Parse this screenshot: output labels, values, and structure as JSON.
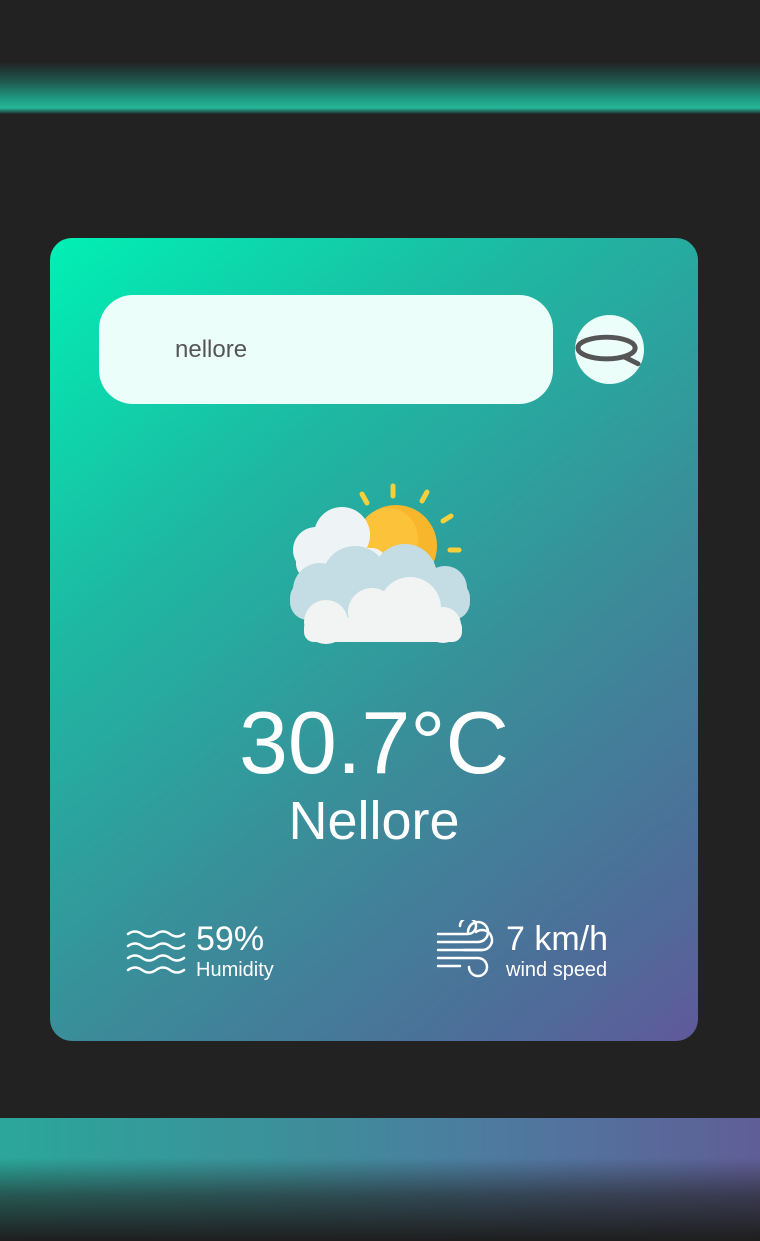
{
  "search": {
    "value": "nellore",
    "button_icon": "search-icon"
  },
  "weather": {
    "icon": "partly-cloudy-icon",
    "temperature": "30.7°C",
    "city": "Nellore"
  },
  "details": {
    "humidity": {
      "icon": "humidity-icon",
      "value": "59%",
      "label": "Humidity"
    },
    "wind": {
      "icon": "wind-icon",
      "value": "7 km/h",
      "label": "wind speed"
    }
  },
  "colors": {
    "background": "#222222",
    "card_gradient_start": "#00f0b5",
    "card_gradient_end": "#60599a",
    "input_bg": "#ebfefa",
    "text": "#ffffff"
  }
}
